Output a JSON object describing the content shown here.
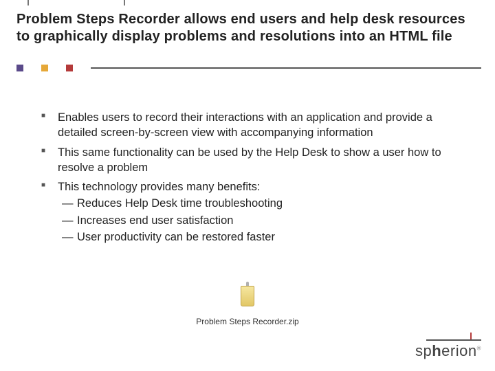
{
  "title": "Problem Steps Recorder allows end users and help desk resources to graphically display problems and resolutions into an HTML file",
  "bullets": [
    {
      "text": "Enables users to record their interactions with an application and provide a detailed screen-by-screen view with accompanying information"
    },
    {
      "text": "This same functionality can be used by the Help Desk to show a user how to resolve a problem"
    },
    {
      "text": "This technology provides many benefits:",
      "sub": [
        "Reduces Help Desk time troubleshooting",
        "Increases end user satisfaction",
        "User productivity can be restored faster"
      ]
    }
  ],
  "attachment": {
    "filename": "Problem Steps Recorder.zip"
  },
  "logo": {
    "brand_prefix": "sp",
    "brand_bold": "h",
    "brand_suffix": "erion",
    "mark": "®"
  },
  "colors": {
    "purple": "#5a4a8a",
    "orange": "#e6a838",
    "red": "#b43a3a",
    "rule": "#555"
  }
}
